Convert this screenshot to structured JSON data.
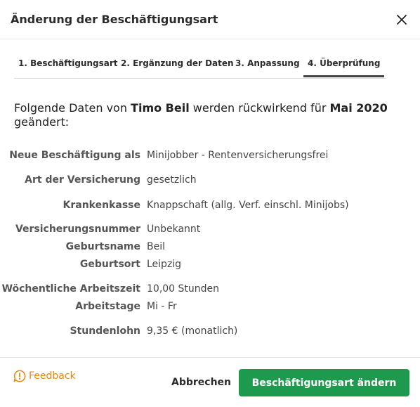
{
  "dialog": {
    "title": "Änderung der Beschäftigungsart"
  },
  "tabs": [
    {
      "label": "1. Beschäftigungsart",
      "active": false
    },
    {
      "label": "2. Ergänzung der Daten",
      "active": false
    },
    {
      "label": "3. Anpassung",
      "active": false
    },
    {
      "label": "4. Überprüfung",
      "active": true
    }
  ],
  "intro": {
    "prefix": "Folgende Daten von ",
    "name": "Timo Beil",
    "middle": " werden rückwirkend für ",
    "month": "Mai 2020",
    "suffix": " geändert:"
  },
  "details": [
    {
      "label": "Neue Beschäftigung als",
      "value": "Minijobber - Rentenversicherungsfrei"
    },
    {
      "label": "Art der Versicherung",
      "value": "gesetzlich"
    },
    {
      "label": "Krankenkasse",
      "value": "Knappschaft (allg. Verf. einschl. Minijobs)"
    },
    {
      "label": "Versicherungsnummer",
      "value": "Unbekannt"
    },
    {
      "label": "Geburtsname",
      "value": "Beil"
    },
    {
      "label": "Geburtsort",
      "value": "Leipzig"
    },
    {
      "label": "Wöchentliche Arbeitszeit",
      "value": "10,00 Stunden"
    },
    {
      "label": "Arbeitstage",
      "value": "Mi - Fr"
    },
    {
      "label": "Stundenlohn",
      "value": "9,35 € (monatlich)"
    }
  ],
  "footer": {
    "feedback_label": "Feedback",
    "cancel_label": "Abbrechen",
    "confirm_label": "Beschäftigungsart ändern"
  },
  "icons": {
    "close": "close-icon",
    "feedback": "alert-circle-icon"
  },
  "colors": {
    "primary": "#1e9a4f",
    "feedback": "#e8860a",
    "active_tab_underline": "#444444"
  }
}
